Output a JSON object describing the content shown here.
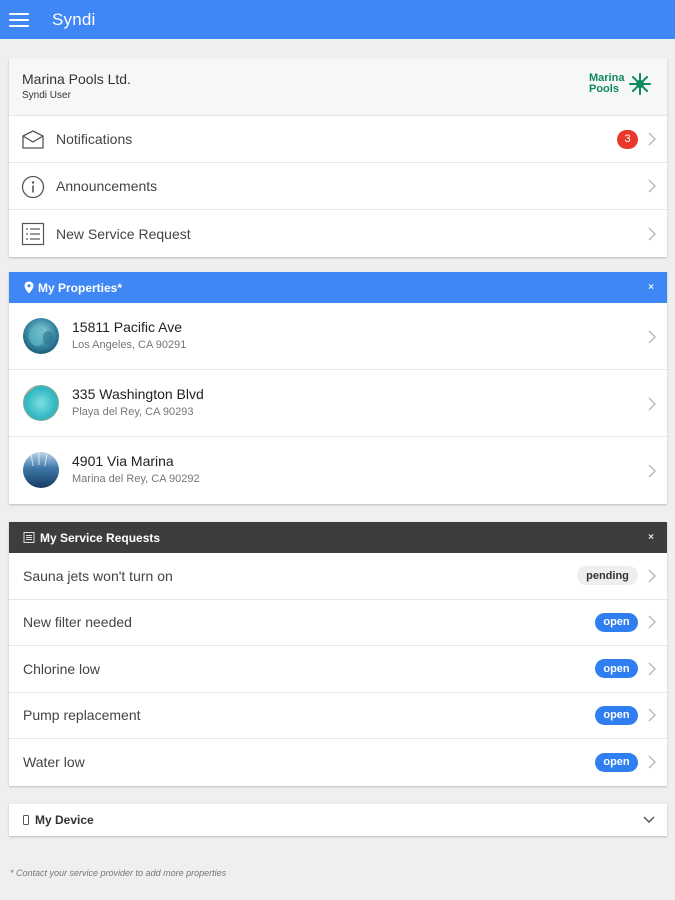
{
  "app": {
    "title": "Syndi"
  },
  "account": {
    "company": "Marina Pools Ltd.",
    "role": "Syndi User",
    "logo_line1": "Marina",
    "logo_line2": "Pools",
    "logo_color": "#0d8a5c"
  },
  "menu": [
    {
      "label": "Notifications",
      "icon": "envelope-icon",
      "badge": "3"
    },
    {
      "label": "Announcements",
      "icon": "info-icon"
    },
    {
      "label": "New Service Request",
      "icon": "list-icon"
    }
  ],
  "properties": {
    "title": "My Properties*",
    "close": "×",
    "items": [
      {
        "street": "15811 Pacific Ave",
        "city": "Los Angeles, CA 90291"
      },
      {
        "street": "335 Washington Blvd",
        "city": "Playa del Rey, CA 90293"
      },
      {
        "street": "4901 Via Marina",
        "city": "Marina del Rey, CA 90292"
      }
    ]
  },
  "requests": {
    "title": "My Service Requests",
    "close": "×",
    "items": [
      {
        "title": "Sauna jets won't turn on",
        "status": "pending"
      },
      {
        "title": "New filter needed",
        "status": "open"
      },
      {
        "title": "Chlorine low",
        "status": "open"
      },
      {
        "title": "Pump replacement",
        "status": "open"
      },
      {
        "title": "Water low",
        "status": "open"
      }
    ]
  },
  "device": {
    "title": "My Device"
  },
  "footnote": "* Contact your service provider to add more properties",
  "colors": {
    "appbar": "#3f87f5",
    "badge": "#e8392c",
    "open_status": "#2f7ff0",
    "dark_header": "#3d3d3d"
  }
}
